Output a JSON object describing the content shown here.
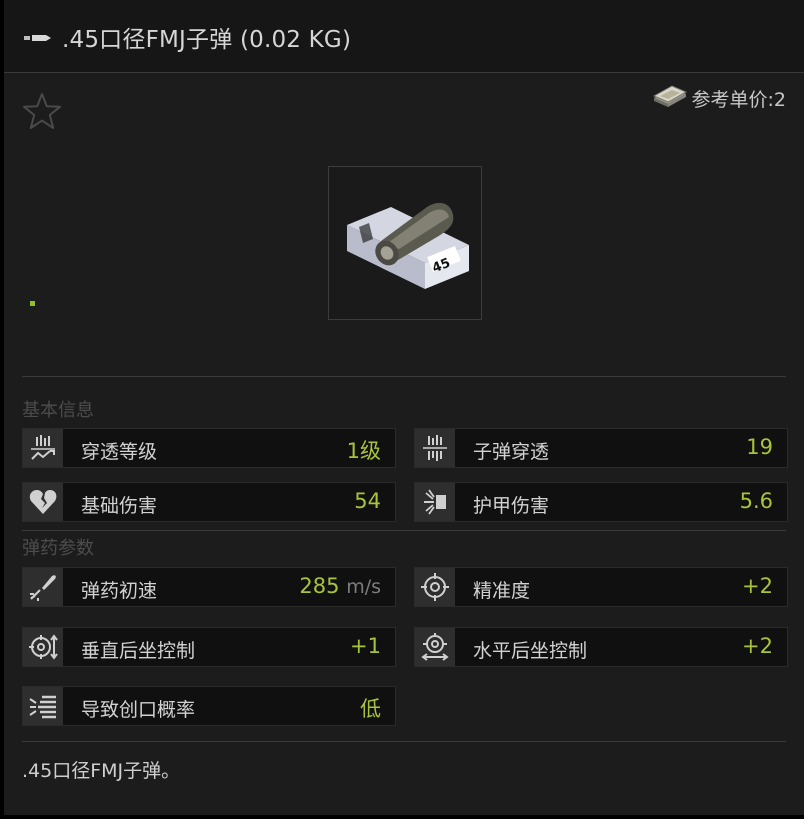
{
  "window": {
    "title": ".45口径FMJ子弹 (0.02 KG)"
  },
  "header": {
    "price_label": "参考单价:2",
    "favorite_icon": "star-outline-icon",
    "price_icon": "cash-stack-icon"
  },
  "item": {
    "image_caption": "45"
  },
  "sections": {
    "basic_info": "基本信息",
    "ammo_params": "弹药参数"
  },
  "basic_stats": [
    {
      "label": "穿透等级",
      "value": "1级",
      "icon": "penetration-level-icon"
    },
    {
      "label": "子弹穿透",
      "value": "19",
      "icon": "bullet-penetration-icon"
    },
    {
      "label": "基础伤害",
      "value": "54",
      "icon": "broken-heart-icon"
    },
    {
      "label": "护甲伤害",
      "value": "5.6",
      "icon": "armor-damage-icon"
    }
  ],
  "ammo_stats": [
    {
      "label": "弹药初速",
      "value": "285",
      "unit": "m/s",
      "icon": "muzzle-velocity-icon"
    },
    {
      "label": "精准度",
      "value": "+2",
      "icon": "crosshair-icon"
    },
    {
      "label": "垂直后坐控制",
      "value": "+1",
      "icon": "vertical-recoil-icon"
    },
    {
      "label": "水平后坐控制",
      "value": "+2",
      "icon": "horizontal-recoil-icon"
    },
    {
      "label": "导致创口概率",
      "value": "低",
      "icon": "bleeding-chance-icon"
    }
  ],
  "description": ".45口径FMJ子弹。",
  "colors": {
    "accent_value": "#a8c43b",
    "panel_bg": "#1c1c1c",
    "title_bg": "#161616",
    "indicator_green": "#8fbf2e"
  }
}
